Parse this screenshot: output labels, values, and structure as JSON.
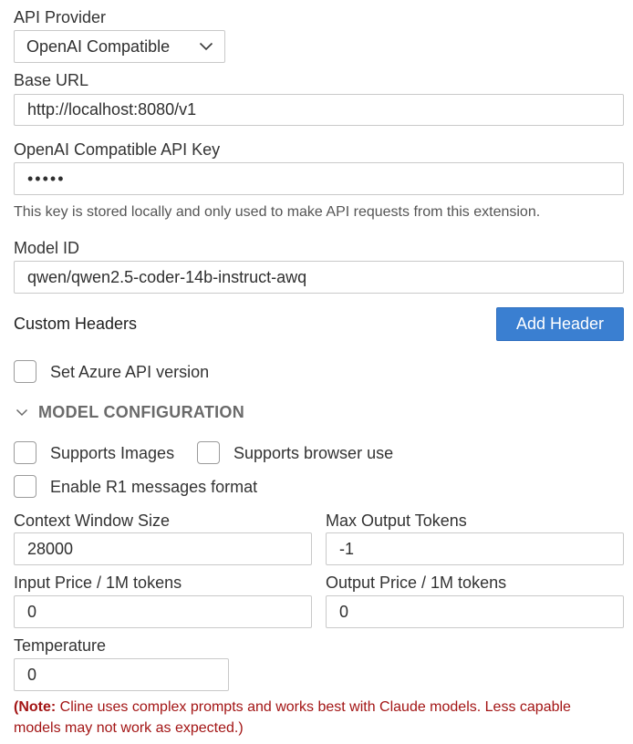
{
  "provider": {
    "label": "API Provider",
    "value": "OpenAI Compatible"
  },
  "base_url": {
    "label": "Base URL",
    "value": "http://localhost:8080/v1"
  },
  "api_key": {
    "label": "OpenAI Compatible API Key",
    "value": "•••••",
    "help": "This key is stored locally and only used to make API requests from this extension."
  },
  "model_id": {
    "label": "Model ID",
    "value": "qwen/qwen2.5-coder-14b-instruct-awq"
  },
  "custom_headers": {
    "label": "Custom Headers",
    "add_button": "Add Header"
  },
  "azure": {
    "label": "Set Azure API version"
  },
  "model_config": {
    "title": "MODEL CONFIGURATION",
    "supports_images": "Supports Images",
    "supports_browser": "Supports browser use",
    "enable_r1": "Enable R1 messages format",
    "context_window": {
      "label": "Context Window Size",
      "value": "28000"
    },
    "max_output": {
      "label": "Max Output Tokens",
      "value": "-1"
    },
    "input_price": {
      "label": "Input Price / 1M tokens",
      "value": "0"
    },
    "output_price": {
      "label": "Output Price / 1M tokens",
      "value": "0"
    },
    "temperature": {
      "label": "Temperature",
      "value": "0"
    }
  },
  "note": {
    "prefix": "(Note:",
    "text": " Cline uses complex prompts and works best with Claude models. Less capable models may not work as expected.)"
  },
  "colors": {
    "accent": "#3a7fd1",
    "note": "#a31515"
  }
}
